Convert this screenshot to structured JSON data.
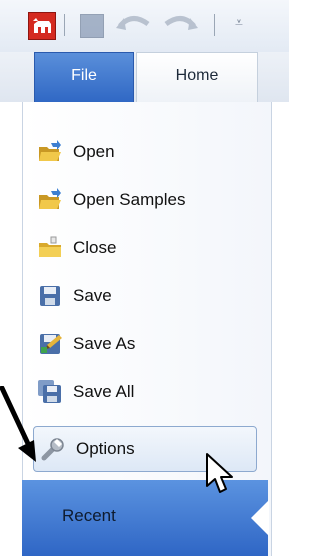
{
  "toolbar": {
    "app_icon": "app-logo-icon",
    "save_icon": "save-icon",
    "undo_icon": "undo-icon",
    "redo_icon": "redo-icon",
    "customize_icon": "customize-toolbar-icon",
    "customize_glyph": "⩡"
  },
  "tabs": {
    "file": "File",
    "home": "Home"
  },
  "menu": {
    "items": [
      {
        "label": "Open",
        "icon": "open-folder-icon"
      },
      {
        "label": "Open Samples",
        "icon": "open-samples-icon"
      },
      {
        "label": "Close",
        "icon": "close-folder-icon"
      },
      {
        "label": "Save",
        "icon": "save-icon"
      },
      {
        "label": "Save As",
        "icon": "save-as-icon"
      },
      {
        "label": "Save All",
        "icon": "save-all-icon"
      },
      {
        "label": "Options",
        "icon": "options-wrench-icon"
      }
    ],
    "recent": "Recent"
  },
  "colors": {
    "accent": "#2f67c4",
    "folder": "#e8b735",
    "disk": "#4a6fa8"
  }
}
